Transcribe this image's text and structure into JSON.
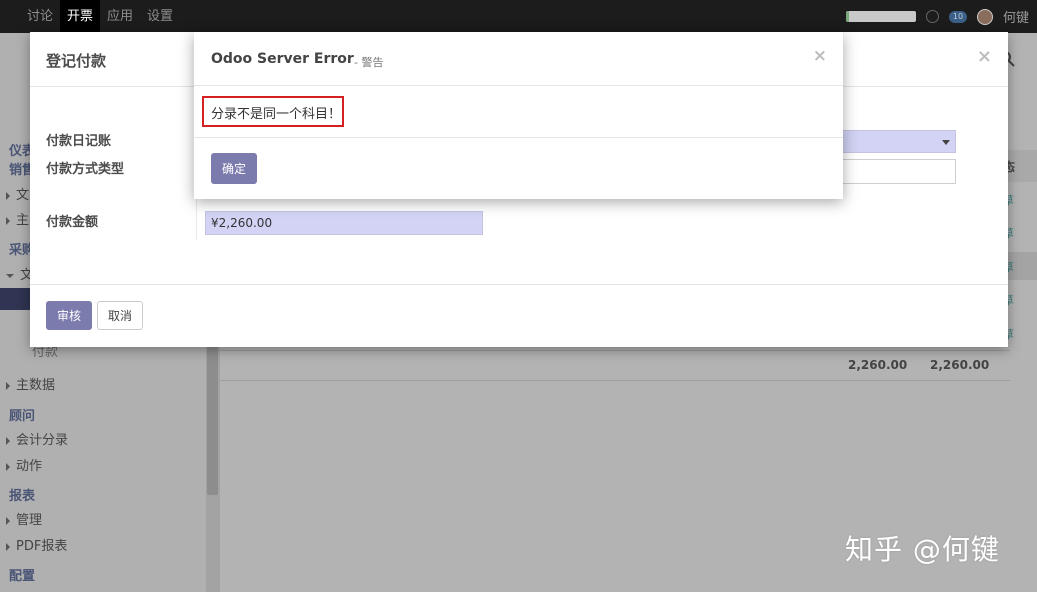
{
  "topbar": {
    "menu": [
      "讨论",
      "开票",
      "应用",
      "设置"
    ],
    "active_index": 1,
    "chat_count": "10",
    "user_name": "何键",
    "progress_fraction": 0.05
  },
  "sidebar": {
    "items": [
      {
        "kind": "head",
        "label": "仪表"
      },
      {
        "kind": "head",
        "label": "销售"
      },
      {
        "kind": "item",
        "label": "文"
      },
      {
        "kind": "item",
        "label": "主"
      },
      {
        "kind": "head",
        "label": "采购"
      },
      {
        "kind": "item",
        "label": "文"
      },
      {
        "kind": "item",
        "label": "付款"
      },
      {
        "kind": "item",
        "label": "主数据"
      },
      {
        "kind": "head",
        "label": "顾问"
      },
      {
        "kind": "item",
        "label": "会计分录"
      },
      {
        "kind": "item",
        "label": "动作"
      },
      {
        "kind": "head",
        "label": "报表"
      },
      {
        "kind": "item",
        "label": "管理"
      },
      {
        "kind": "item",
        "label": "PDF报表"
      },
      {
        "kind": "head",
        "label": "配置"
      }
    ]
  },
  "main": {
    "totals": [
      "2,260.00",
      "2,260.00"
    ],
    "right_col_header": "态",
    "right_col_cells": [
      "草",
      "草",
      "草",
      "草",
      "草"
    ]
  },
  "payment_dialog": {
    "title": "登记付款",
    "journal_label": "付款日记账",
    "method_label": "付款方式类型",
    "amount_label": "付款金额",
    "amount_value": "¥2,260.00",
    "confirm_label": "审核",
    "cancel_label": "取消",
    "close_glyph": "×"
  },
  "error_dialog": {
    "title": "Odoo Server Error",
    "subtitle": "- 警告",
    "message": "分录不是同一个科目！",
    "ok_label": "确定",
    "close_glyph": "×"
  },
  "watermark": "知乎 @何键"
}
